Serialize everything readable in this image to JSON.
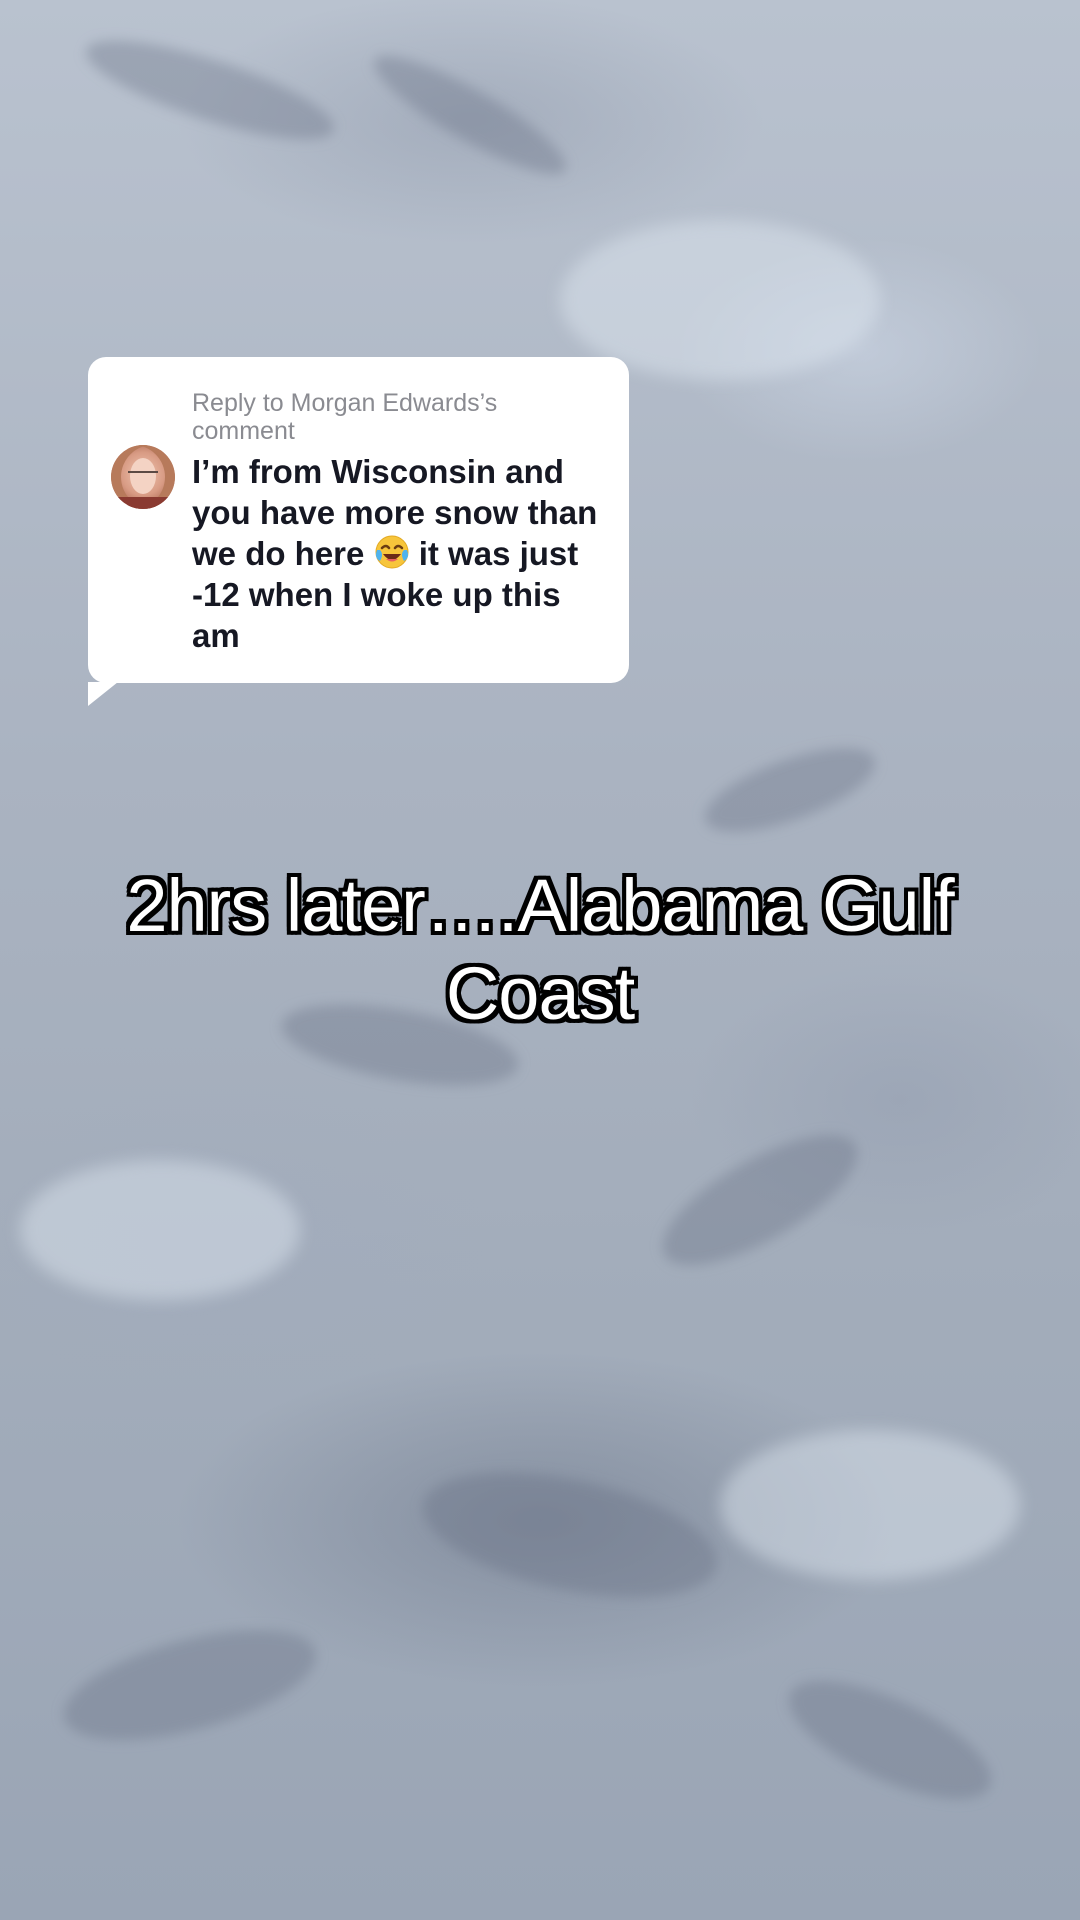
{
  "reply_card": {
    "header": "Reply to Morgan Edwards’s comment",
    "comment_before_emoji": "I’m from Wisconsin and you have more snow than we do here",
    "emoji_name": "face-with-tears-of-joy-icon",
    "comment_after_emoji": "it was just -12 when I woke up this am",
    "avatar_name": "avatar"
  },
  "caption": {
    "text": "2hrs later….Alabama Gulf Coast"
  },
  "colors": {
    "card_background": "#ffffff",
    "header_text": "#8a8b91",
    "body_text": "#161823",
    "caption_text": "#ffffff",
    "caption_outline": "#000000"
  }
}
